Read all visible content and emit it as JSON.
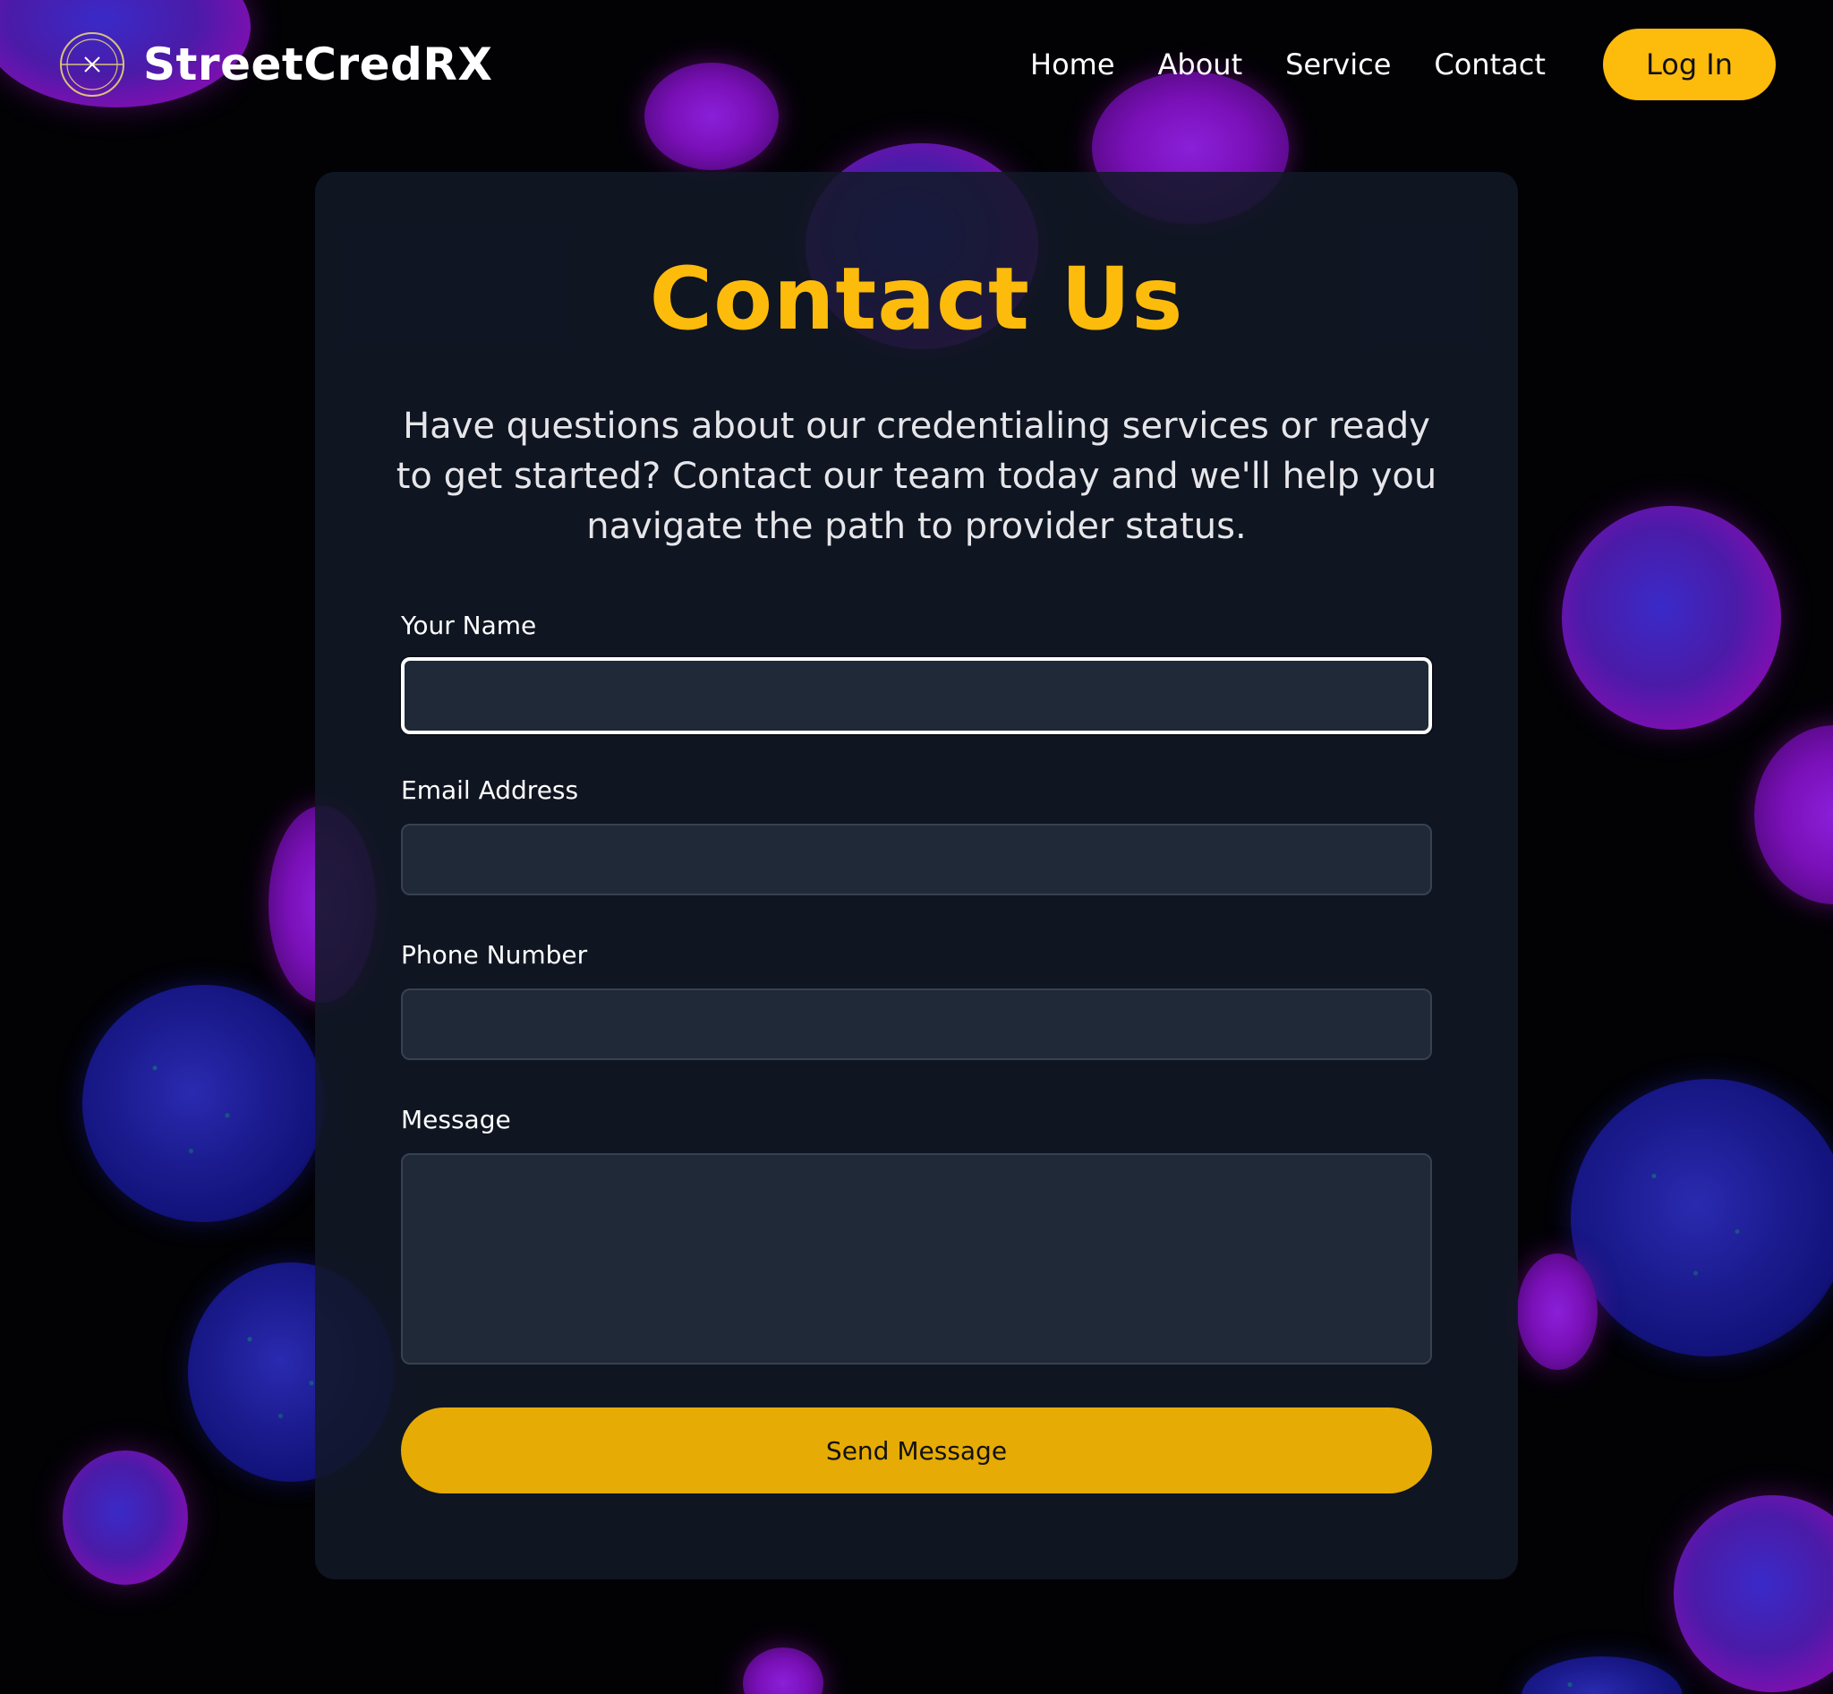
{
  "brand": {
    "name": "StreetCredRX",
    "logo_icon": "crossed-circle-logo-icon"
  },
  "nav": {
    "items": [
      {
        "label": "Home"
      },
      {
        "label": "About"
      },
      {
        "label": "Service"
      },
      {
        "label": "Contact"
      }
    ],
    "login_label": "Log In"
  },
  "contact": {
    "title": "Contact Us",
    "intro": "Have questions about our credentialing services or ready to get started? Contact our team today and we'll help you navigate the path to provider status.",
    "fields": {
      "name_label": "Your Name",
      "name_value": "",
      "email_label": "Email Address",
      "email_value": "",
      "phone_label": "Phone Number",
      "phone_value": "",
      "message_label": "Message",
      "message_value": ""
    },
    "submit_label": "Send Message"
  },
  "colors": {
    "accent": "#fdbb0c",
    "submit": "#e6ab05",
    "card": "#111827",
    "input": "#1f2937"
  }
}
